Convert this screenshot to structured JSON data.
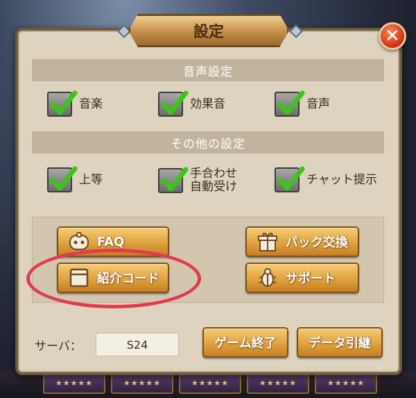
{
  "title": "設定",
  "sound_section": {
    "heading": "音声設定",
    "options": [
      {
        "label": "音楽",
        "checked": true
      },
      {
        "label": "効果音",
        "checked": true
      },
      {
        "label": "音声",
        "checked": true
      }
    ]
  },
  "other_section": {
    "heading": "その他の設定",
    "options": [
      {
        "label": "上等",
        "checked": true
      },
      {
        "label_line1": "手合わせ",
        "label_line2": "自動受け",
        "checked": true
      },
      {
        "label": "チャット提示",
        "checked": true
      }
    ]
  },
  "buttons": {
    "faq": "FAQ",
    "referral": "紹介コード",
    "pack_exchange": "パック交換",
    "support": "サポート",
    "quit_game": "ゲーム終了",
    "data_transfer": "データ引継"
  },
  "server": {
    "label": "サーバ：",
    "value": "S24"
  },
  "background_cards": [
    "★★★★★",
    "★★★★★",
    "★★★★★",
    "★★★★★",
    "★★★★★"
  ],
  "colors": {
    "panel": "#ddd3bf",
    "section_bar": "#c0b49c",
    "gold_button": "#e0a240",
    "check_green": "#3cc41a",
    "highlight_ellipse": "#e23a50",
    "close_red": "#d63a1a"
  },
  "icons": {
    "faq": "game-controller-icon",
    "referral": "card-icon",
    "pack_exchange": "gift-icon",
    "support": "bug-icon",
    "close": "close-icon",
    "check": "checkmark-icon"
  }
}
